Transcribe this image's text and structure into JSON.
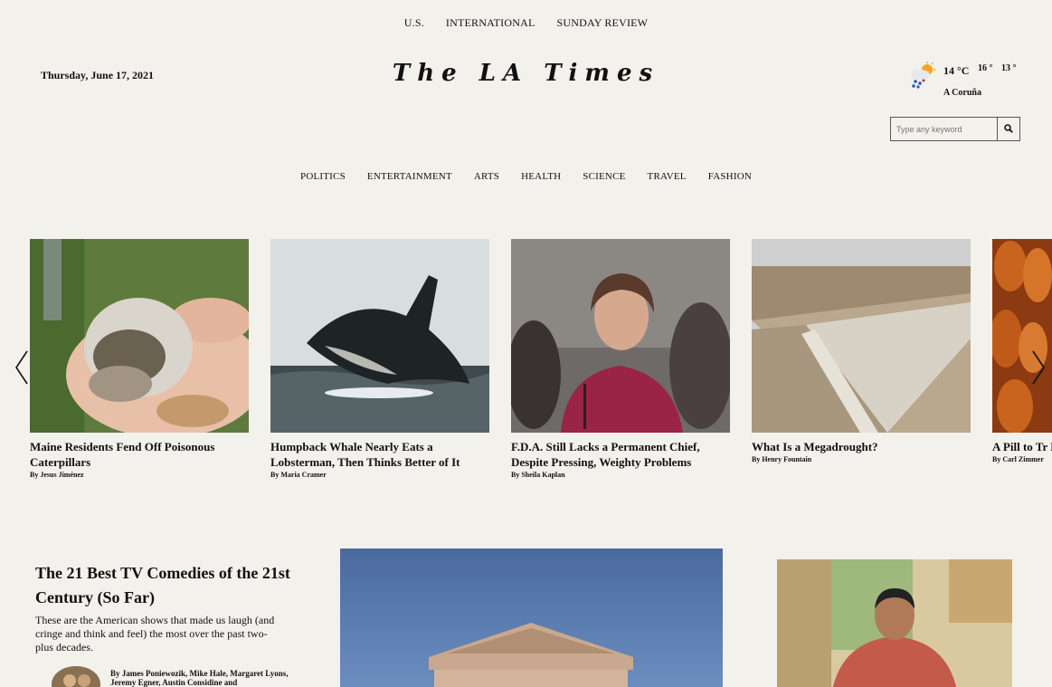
{
  "top_nav": [
    "U.S.",
    "INTERNATIONAL",
    "SUNDAY REVIEW"
  ],
  "date": "Thursday, June 17, 2021",
  "logo": "The LA Times",
  "weather": {
    "temp": "14 °C",
    "high": "16 °",
    "low": "13 °",
    "city": "A Coruña",
    "icon": "partly-cloudy-rain-icon"
  },
  "search": {
    "placeholder": "Type any keyword",
    "icon": "search-icon"
  },
  "categories": [
    "POLITICS",
    "ENTERTAINMENT",
    "ARTS",
    "HEALTH",
    "SCIENCE",
    "TRAVEL",
    "FASHION"
  ],
  "carousel": [
    {
      "title": "Maine Residents Fend Off Poisonous Caterpillars",
      "byline": "By Jesus Jiménez"
    },
    {
      "title": "Humpback Whale Nearly Eats a Lobsterman, Then Thinks Better of It",
      "byline": "By Maria Cramer"
    },
    {
      "title": "F.D.A. Still Lacks a Permanent Chief, Despite Pressing, Weighty Problems",
      "byline": "By Sheila Kaplan"
    },
    {
      "title": "What Is a Megadrought?",
      "byline": "By Henry Fountain"
    },
    {
      "title": "A Pill to Tr Betting on",
      "byline": "By Carl Zimmer"
    }
  ],
  "feature": {
    "title": "The 21 Best TV Comedies of the 21st Century (So Far)",
    "summary": "These are the American shows that made us laugh (and cringe and think and feel) the most over the past two-plus decades.",
    "byline": "By James Poniewozik, Mike Hale, Margaret Lyons, Jeremy Egner, Austin Considine and"
  },
  "colors": {
    "background": "#f3f1ec",
    "text": "#111111"
  }
}
